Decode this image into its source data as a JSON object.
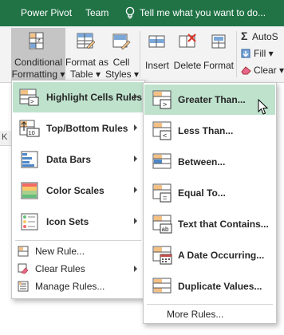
{
  "tabs": {
    "power_pivot": "Power Pivot",
    "team": "Team",
    "tell_me": "Tell me what you want to do..."
  },
  "ribbon": {
    "conditional_formatting": [
      "Conditional",
      "Formatting ▾"
    ],
    "format_as_table": [
      "Format as",
      "Table ▾"
    ],
    "cell_styles": [
      "Cell",
      "Styles ▾"
    ],
    "insert": "Insert",
    "delete": "Delete",
    "format": "Format",
    "autosum": "AutoS",
    "fill": "Fill ▾",
    "clear": "Clear ▾"
  },
  "sheet_cell_letter": "K",
  "main_menu": {
    "items": [
      {
        "label": "Highlight Cells Rules",
        "highlighted": true
      },
      {
        "label": "Top/Bottom Rules"
      },
      {
        "label": "Data Bars"
      },
      {
        "label": "Color Scales"
      },
      {
        "label": "Icon Sets"
      }
    ],
    "small_items": [
      {
        "label": "New Rule..."
      },
      {
        "label": "Clear Rules"
      },
      {
        "label": "Manage Rules..."
      }
    ]
  },
  "sub_menu": {
    "items": [
      {
        "label": "Greater Than...",
        "highlighted": true
      },
      {
        "label": "Less Than..."
      },
      {
        "label": "Between..."
      },
      {
        "label": "Equal To..."
      },
      {
        "label": "Text that Contains..."
      },
      {
        "label": "A Date Occurring..."
      },
      {
        "label": "Duplicate Values..."
      }
    ],
    "more_rules": "More Rules..."
  },
  "colors": {
    "brand": "#217346",
    "highlight": "#bfe2cd",
    "ribbon_bg": "#f3f3f3"
  },
  "icons": {
    "tell_me": "lightbulb-icon",
    "conditional_formatting": "conditional-formatting-icon",
    "format_as_table": "table-format-icon",
    "cell_styles": "cell-styles-icon",
    "insert": "insert-cells-icon",
    "delete": "delete-cells-icon",
    "format": "format-cells-icon",
    "autosum": "sigma-icon",
    "fill": "fill-down-icon",
    "clear": "eraser-icon",
    "mouse": "mouse-pointer-icon"
  }
}
